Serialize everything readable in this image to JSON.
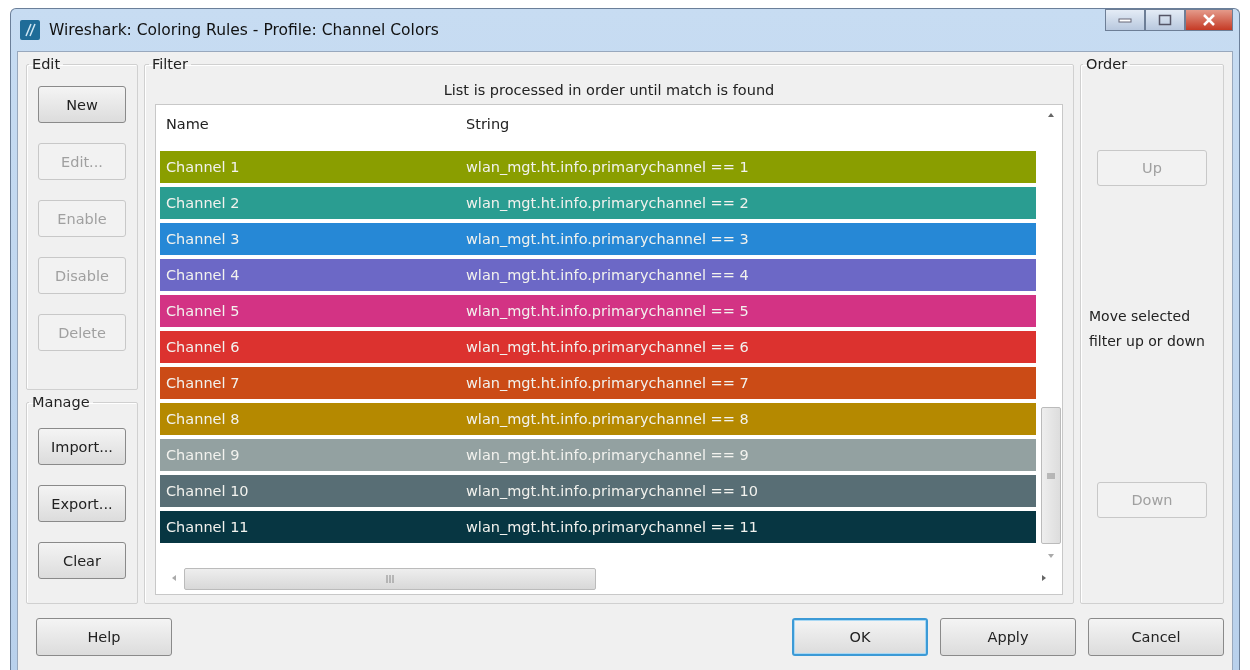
{
  "window": {
    "title": "Wireshark: Coloring Rules - Profile: Channel Colors"
  },
  "edit_group": {
    "title": "Edit",
    "buttons": [
      {
        "label": "New",
        "disabled": false
      },
      {
        "label": "Edit...",
        "disabled": true
      },
      {
        "label": "Enable",
        "disabled": true
      },
      {
        "label": "Disable",
        "disabled": true
      },
      {
        "label": "Delete",
        "disabled": true
      }
    ]
  },
  "manage_group": {
    "title": "Manage",
    "buttons": [
      {
        "label": "Import...",
        "disabled": false
      },
      {
        "label": "Export...",
        "disabled": false
      },
      {
        "label": "Clear",
        "disabled": false
      }
    ]
  },
  "filter_group": {
    "title": "Filter",
    "note": "List is processed in order until match is found",
    "columns": [
      "Name",
      "String"
    ],
    "rows": [
      {
        "name": "Channel 1",
        "string": "wlan_mgt.ht.info.primarychannel == 1",
        "color": "#8a9e00"
      },
      {
        "name": "Channel 2",
        "string": "wlan_mgt.ht.info.primarychannel == 2",
        "color": "#2a9d91"
      },
      {
        "name": "Channel 3",
        "string": "wlan_mgt.ht.info.primarychannel == 3",
        "color": "#2688d6"
      },
      {
        "name": "Channel 4",
        "string": "wlan_mgt.ht.info.primarychannel == 4",
        "color": "#6c68c6"
      },
      {
        "name": "Channel 5",
        "string": "wlan_mgt.ht.info.primarychannel == 5",
        "color": "#d33384"
      },
      {
        "name": "Channel 6",
        "string": "wlan_mgt.ht.info.primarychannel == 6",
        "color": "#dc322f"
      },
      {
        "name": "Channel 7",
        "string": "wlan_mgt.ht.info.primarychannel == 7",
        "color": "#cb4b16"
      },
      {
        "name": "Channel 8",
        "string": "wlan_mgt.ht.info.primarychannel == 8",
        "color": "#b58900"
      },
      {
        "name": "Channel 9",
        "string": "wlan_mgt.ht.info.primarychannel == 9",
        "color": "#93a1a1"
      },
      {
        "name": "Channel 10",
        "string": "wlan_mgt.ht.info.primarychannel == 10",
        "color": "#586e75"
      },
      {
        "name": "Channel 11",
        "string": "wlan_mgt.ht.info.primarychannel == 11",
        "color": "#073642"
      }
    ]
  },
  "order_group": {
    "title": "Order",
    "up": {
      "label": "Up",
      "disabled": true
    },
    "hint": "Move selected filter up or down",
    "down": {
      "label": "Down",
      "disabled": true
    }
  },
  "footer_buttons": [
    {
      "label": "Help",
      "selected": false
    },
    {
      "label": "OK",
      "selected": true
    },
    {
      "label": "Apply",
      "selected": false
    },
    {
      "label": "Cancel",
      "selected": false
    }
  ]
}
